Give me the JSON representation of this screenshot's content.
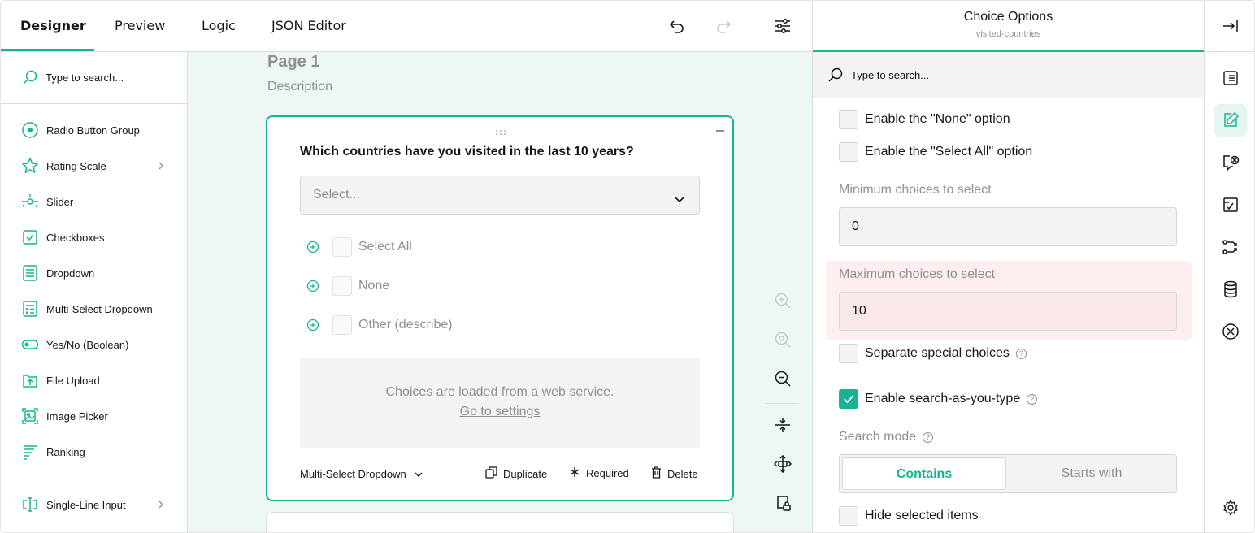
{
  "tabs": [
    {
      "label": "Designer",
      "active": true
    },
    {
      "label": "Preview",
      "active": false
    },
    {
      "label": "Logic",
      "active": false
    },
    {
      "label": "JSON Editor",
      "active": false
    }
  ],
  "toolbar": {
    "icons": [
      "undo-icon",
      "redo-icon",
      "settings-sliders-icon"
    ]
  },
  "toolbox": {
    "search_placeholder": "Type to search...",
    "items": [
      {
        "label": "Radio Button Group",
        "icon": "radio-icon",
        "has_submenu": false
      },
      {
        "label": "Rating Scale",
        "icon": "star-icon",
        "has_submenu": true
      },
      {
        "label": "Slider",
        "icon": "slider-icon",
        "has_submenu": false
      },
      {
        "label": "Checkboxes",
        "icon": "checkbox-icon",
        "has_submenu": false
      },
      {
        "label": "Dropdown",
        "icon": "dropdown-icon",
        "has_submenu": false
      },
      {
        "label": "Multi-Select Dropdown",
        "icon": "multi-dropdown-icon",
        "has_submenu": false
      },
      {
        "label": "Yes/No (Boolean)",
        "icon": "toggle-icon",
        "has_submenu": false
      },
      {
        "label": "File Upload",
        "icon": "file-upload-icon",
        "has_submenu": false
      },
      {
        "label": "Image Picker",
        "icon": "image-picker-icon",
        "has_submenu": false
      },
      {
        "label": "Ranking",
        "icon": "ranking-icon",
        "has_submenu": false
      },
      {
        "label": "Single-Line Input",
        "icon": "text-input-icon",
        "has_submenu": true
      }
    ]
  },
  "canvas": {
    "page_title": "Page 1",
    "page_description": "Description",
    "question": {
      "title": "Which countries have you visited in the last 10 years?",
      "select_placeholder": "Select...",
      "choices": [
        "Select All",
        "None",
        "Other (describe)"
      ],
      "webservice_message": "Choices are loaded from a web service.",
      "webservice_link": "Go to settings",
      "type_label": "Multi-Select Dropdown",
      "actions": {
        "duplicate": "Duplicate",
        "required": "Required",
        "delete": "Delete"
      }
    }
  },
  "property_panel": {
    "title": "Choice Options",
    "subtitle": "visited-countries",
    "search_placeholder": "Type to search...",
    "enable_none": {
      "label": "Enable the \"None\" option",
      "checked": false
    },
    "enable_select_all": {
      "label": "Enable the \"Select All\" option",
      "checked": false
    },
    "min_choices": {
      "label": "Minimum choices to select",
      "value": "0"
    },
    "max_choices": {
      "label": "Maximum choices to select",
      "value": "10"
    },
    "separate_special": {
      "label": "Separate special choices",
      "checked": false
    },
    "search_as_you_type": {
      "label": "Enable search-as-you-type",
      "checked": true
    },
    "search_mode": {
      "label": "Search mode",
      "options": [
        "Contains",
        "Starts with"
      ],
      "selected": "Contains"
    },
    "hide_selected": {
      "label": "Hide selected items",
      "checked": false
    }
  },
  "colors": {
    "accent": "#19b394",
    "canvas_bg": "#edf8f5",
    "error_bg": "#fdeff0",
    "muted_text": "#909090"
  }
}
